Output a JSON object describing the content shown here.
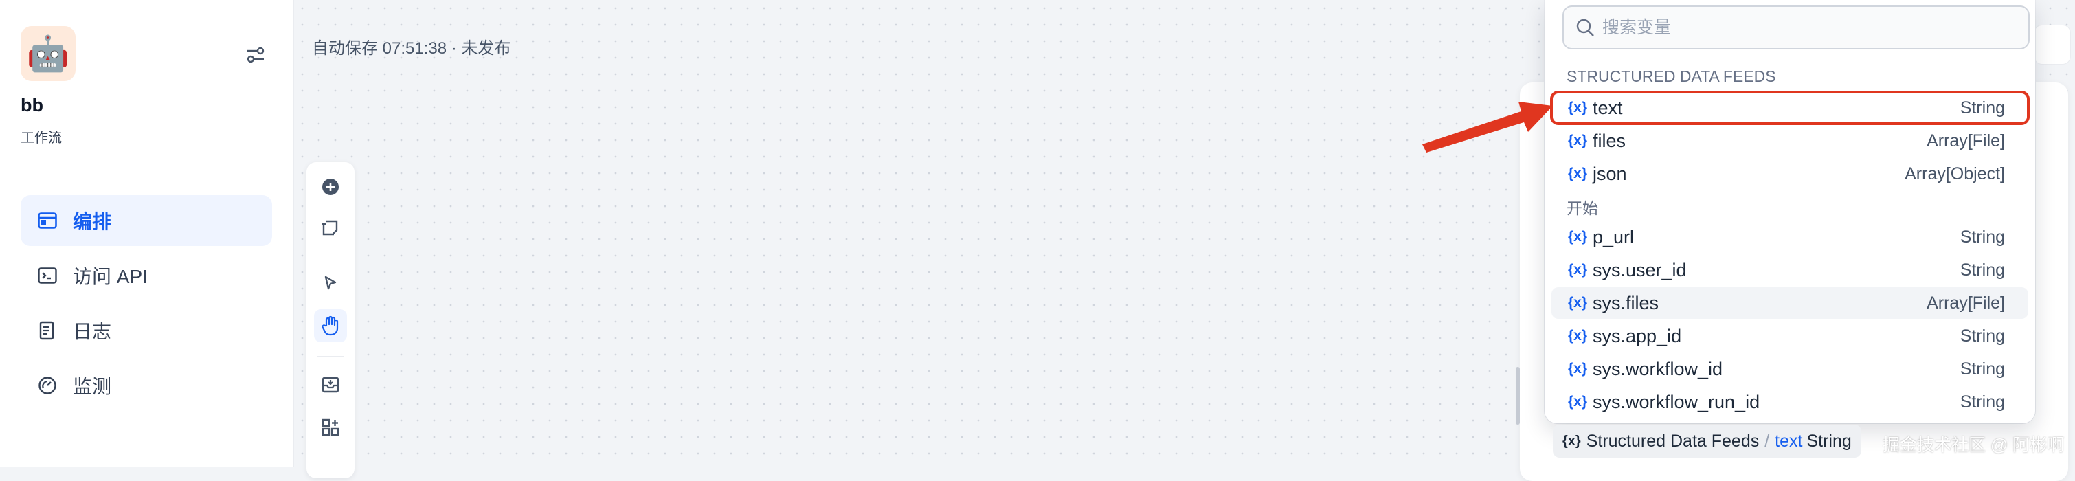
{
  "sidebar": {
    "app_name": "bb",
    "app_type": "工作流",
    "items": [
      {
        "label": "编排",
        "icon": "layout-icon",
        "active": true
      },
      {
        "label": "访问 API",
        "icon": "terminal-icon",
        "active": false
      },
      {
        "label": "日志",
        "icon": "file-list-icon",
        "active": false
      },
      {
        "label": "监测",
        "icon": "gauge-icon",
        "active": false
      }
    ]
  },
  "canvas": {
    "autosave_status": "自动保存 07:51:38 · 未发布"
  },
  "toolbar": {
    "tools": [
      "add-node-icon",
      "add-note-icon",
      "pointer-icon",
      "hand-icon",
      "export-icon",
      "organize-icon"
    ],
    "active_tool": "hand-icon"
  },
  "variable_picker": {
    "search_placeholder": "搜索变量",
    "groups": [
      {
        "title": "STRUCTURED DATA FEEDS",
        "vars": [
          {
            "name": "text",
            "type": "String"
          },
          {
            "name": "files",
            "type": "Array[File]"
          },
          {
            "name": "json",
            "type": "Array[Object]"
          }
        ]
      },
      {
        "title": "开始",
        "vars": [
          {
            "name": "p_url",
            "type": "String"
          },
          {
            "name": "sys.user_id",
            "type": "String"
          },
          {
            "name": "sys.files",
            "type": "Array[File]"
          },
          {
            "name": "sys.app_id",
            "type": "String"
          },
          {
            "name": "sys.workflow_id",
            "type": "String"
          },
          {
            "name": "sys.workflow_run_id",
            "type": "String"
          }
        ]
      }
    ],
    "var_icon_glyph": "{x}",
    "highlight_color": "#e0361f",
    "accent_color": "#155eef"
  },
  "selected_var": {
    "source": "Structured Data Feeds",
    "separator": "/",
    "name": "text",
    "type": "String"
  },
  "watermark": "掘金技术社区 @ 阿彬啊"
}
